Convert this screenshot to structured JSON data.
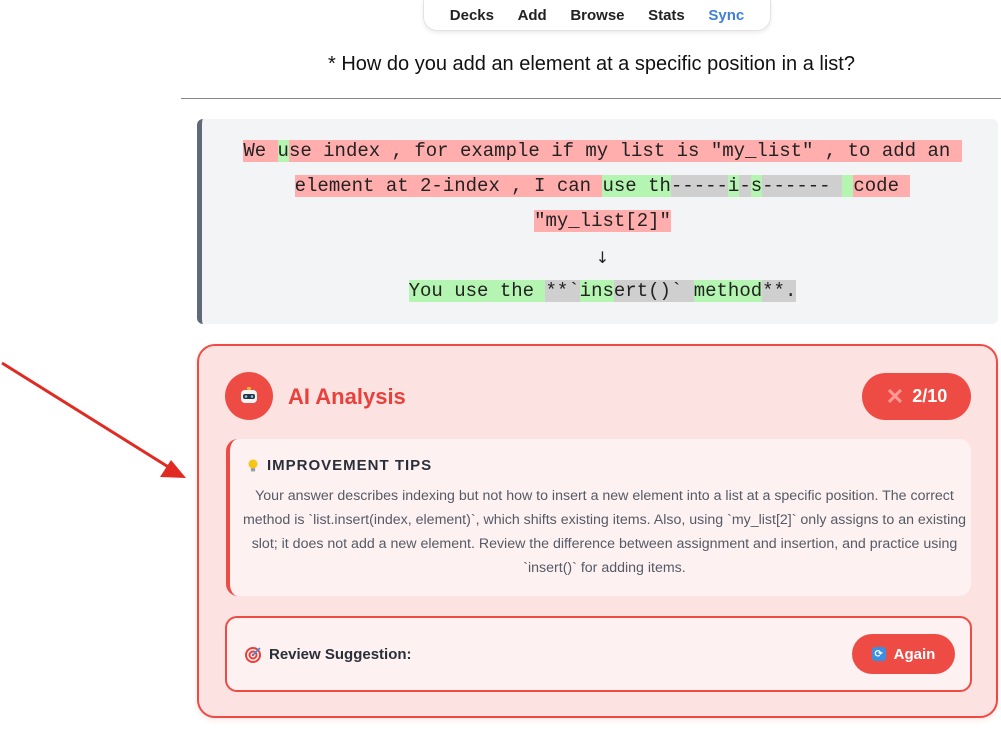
{
  "nav": {
    "items": [
      {
        "label": "Decks"
      },
      {
        "label": "Add"
      },
      {
        "label": "Browse"
      },
      {
        "label": "Stats"
      },
      {
        "label": "Sync",
        "active": true
      }
    ]
  },
  "question": "* How do you add an element at a specific position in a list?",
  "diff": {
    "line1": [
      {
        "t": "We ",
        "k": "bad"
      },
      {
        "t": "u",
        "k": "good"
      },
      {
        "t": "se index , for example if my list is \"my_list\" , to add an ",
        "k": "bad"
      }
    ],
    "line2": [
      {
        "t": "element at 2-index , I can ",
        "k": "bad"
      },
      {
        "t": "use th",
        "k": "good"
      },
      {
        "t": "-----",
        "k": "miss"
      },
      {
        "t": "i",
        "k": "good"
      },
      {
        "t": "-",
        "k": "miss"
      },
      {
        "t": "s",
        "k": "good"
      },
      {
        "t": "------ ",
        "k": "miss"
      },
      {
        "t": " ",
        "k": "good"
      },
      {
        "t": "c",
        "k": "bad"
      },
      {
        "t": "ode ",
        "k": "bad"
      }
    ],
    "line3": [
      {
        "t": "\"my_list[2]\"",
        "k": "bad"
      }
    ],
    "arrow": "↓",
    "line4": [
      {
        "t": "You use the ",
        "k": "good"
      },
      {
        "t": "**`",
        "k": "miss"
      },
      {
        "t": "ins",
        "k": "good"
      },
      {
        "t": "ert()` ",
        "k": "miss"
      },
      {
        "t": "method",
        "k": "good"
      },
      {
        "t": "**.",
        "k": "miss"
      }
    ]
  },
  "ai": {
    "title": "AI Analysis",
    "score": "2/10",
    "tips_heading": "IMPROVEMENT TIPS",
    "tips_text": "Your answer describes indexing but not how to insert a new element into a list at a specific position. The correct method is `list.insert(index, element)`, which shifts existing items. Also, using `my_list[2]` only assigns to an existing slot; it does not add a new element. Review the difference between assignment and insertion, and practice using `insert()` for adding items.",
    "review_label": "Review Suggestion:",
    "again_label": "Again"
  },
  "colors": {
    "accent": "#ef4b45",
    "diff_bad": "#ffadad",
    "diff_good": "#b5f5b2",
    "diff_missing": "#cfcfcf",
    "sync_link": "#3f7fd9"
  }
}
